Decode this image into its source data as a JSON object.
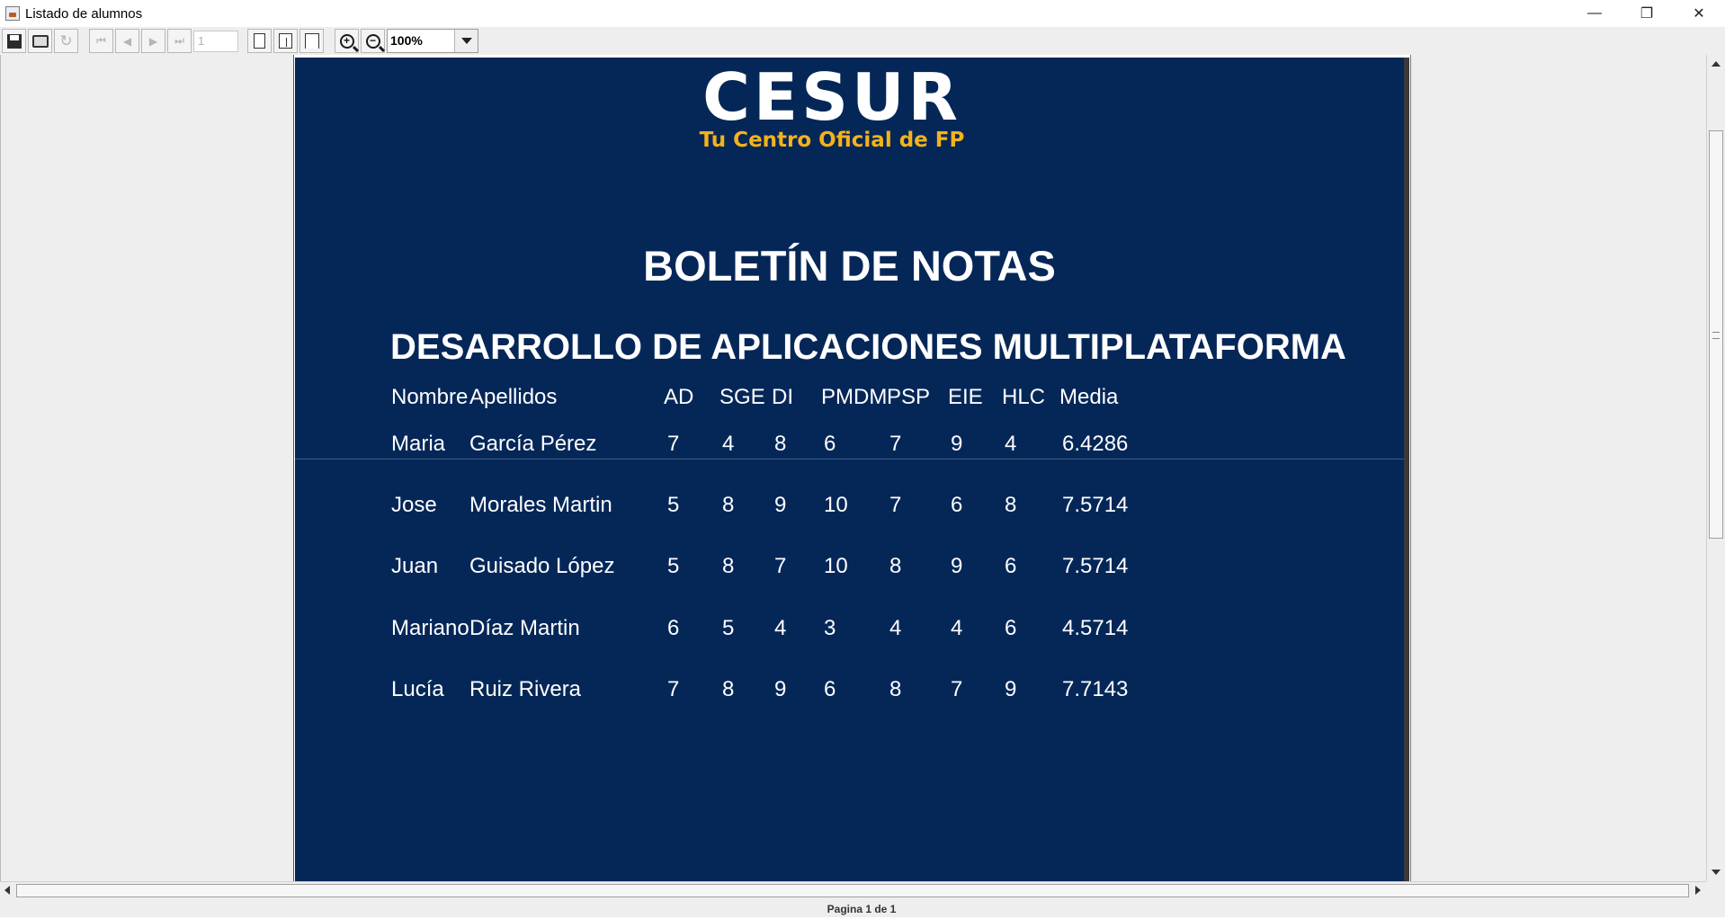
{
  "window": {
    "title": "Listado de alumnos",
    "controls": {
      "minimize": "—",
      "restore": "❐",
      "close": "✕"
    }
  },
  "toolbar": {
    "page_number": "1",
    "zoom": "100%"
  },
  "report": {
    "logo": {
      "main": "CESUR",
      "tagline": "Tu Centro Oficial de FP"
    },
    "title": "BOLETÍN DE NOTAS",
    "subtitle": "DESARROLLO DE APLICACIONES MULTIPLATAFORMA",
    "columns": [
      "Nombre",
      "Apellidos",
      "AD",
      "SGE",
      "DI",
      "PMDM",
      "PSP",
      "EIE",
      "HLC",
      "Media"
    ],
    "rows": [
      [
        "Maria",
        "García Pérez",
        "7",
        "4",
        "8",
        "6",
        "7",
        "9",
        "4",
        "6.4286"
      ],
      [
        "Jose",
        "Morales Martin",
        "5",
        "8",
        "9",
        "10",
        "7",
        "6",
        "8",
        "7.5714"
      ],
      [
        "Juan",
        "Guisado López",
        "5",
        "8",
        "7",
        "10",
        "8",
        "9",
        "6",
        "7.5714"
      ],
      [
        "Mariano",
        "Díaz Martin",
        "6",
        "5",
        "4",
        "3",
        "4",
        "4",
        "6",
        "4.5714"
      ],
      [
        "Lucía",
        "Ruiz Rivera",
        "7",
        "8",
        "9",
        "6",
        "8",
        "7",
        "9",
        "7.7143"
      ]
    ]
  },
  "status": {
    "text": "Pagina 1 de 1"
  },
  "colors": {
    "page_background": "#052758",
    "logo_accent": "#f5b21a"
  }
}
